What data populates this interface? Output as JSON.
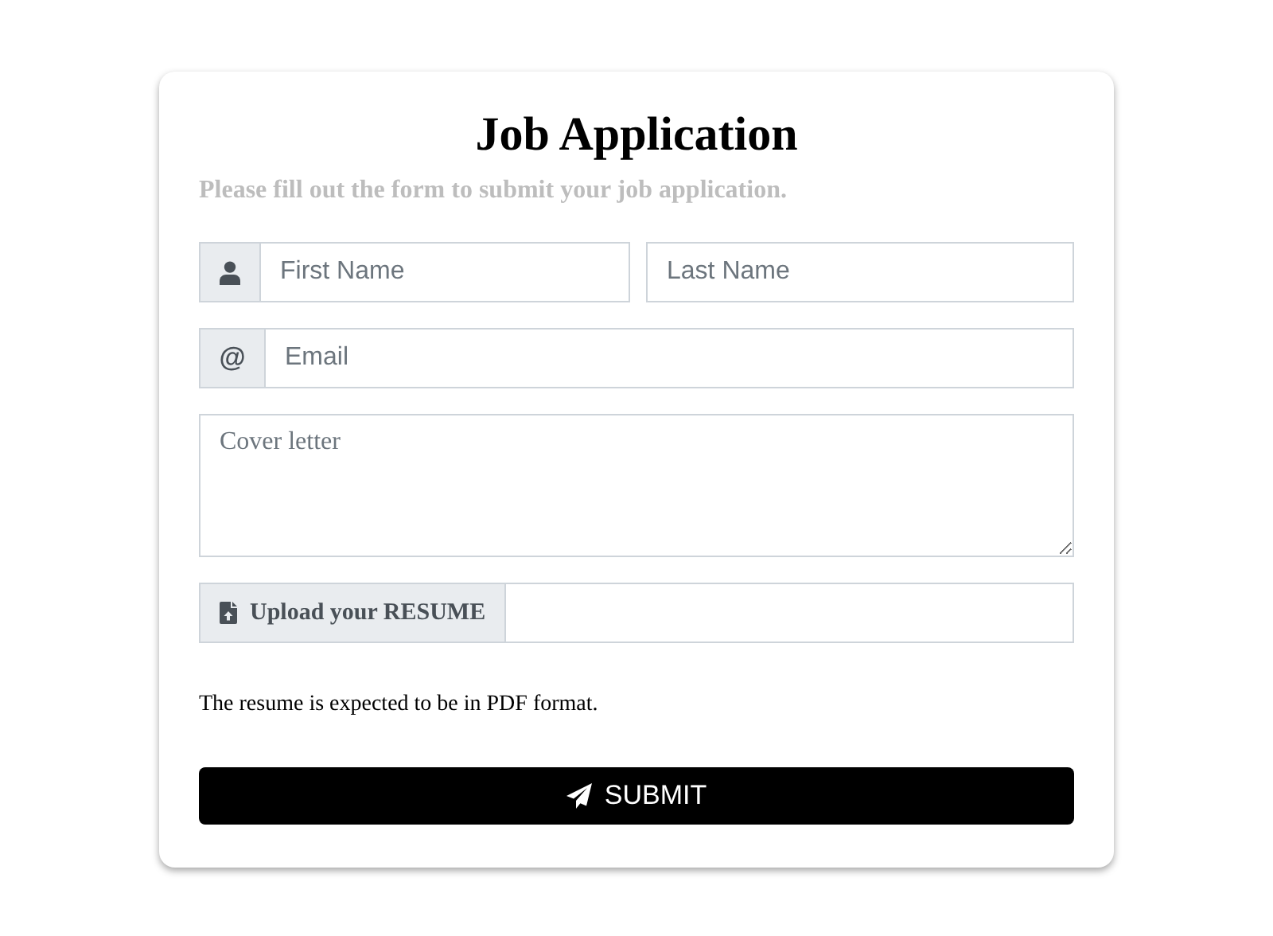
{
  "form": {
    "title": "Job Application",
    "subtitle": "Please fill out the form to submit your job application.",
    "first_name": {
      "placeholder": "First Name"
    },
    "last_name": {
      "placeholder": "Last Name"
    },
    "email": {
      "addon": "@",
      "placeholder": "Email"
    },
    "cover_letter": {
      "placeholder": "Cover letter"
    },
    "upload": {
      "label": "Upload your RESUME"
    },
    "help_text": "The resume is expected to be in PDF format.",
    "submit": "SUBMIT"
  }
}
